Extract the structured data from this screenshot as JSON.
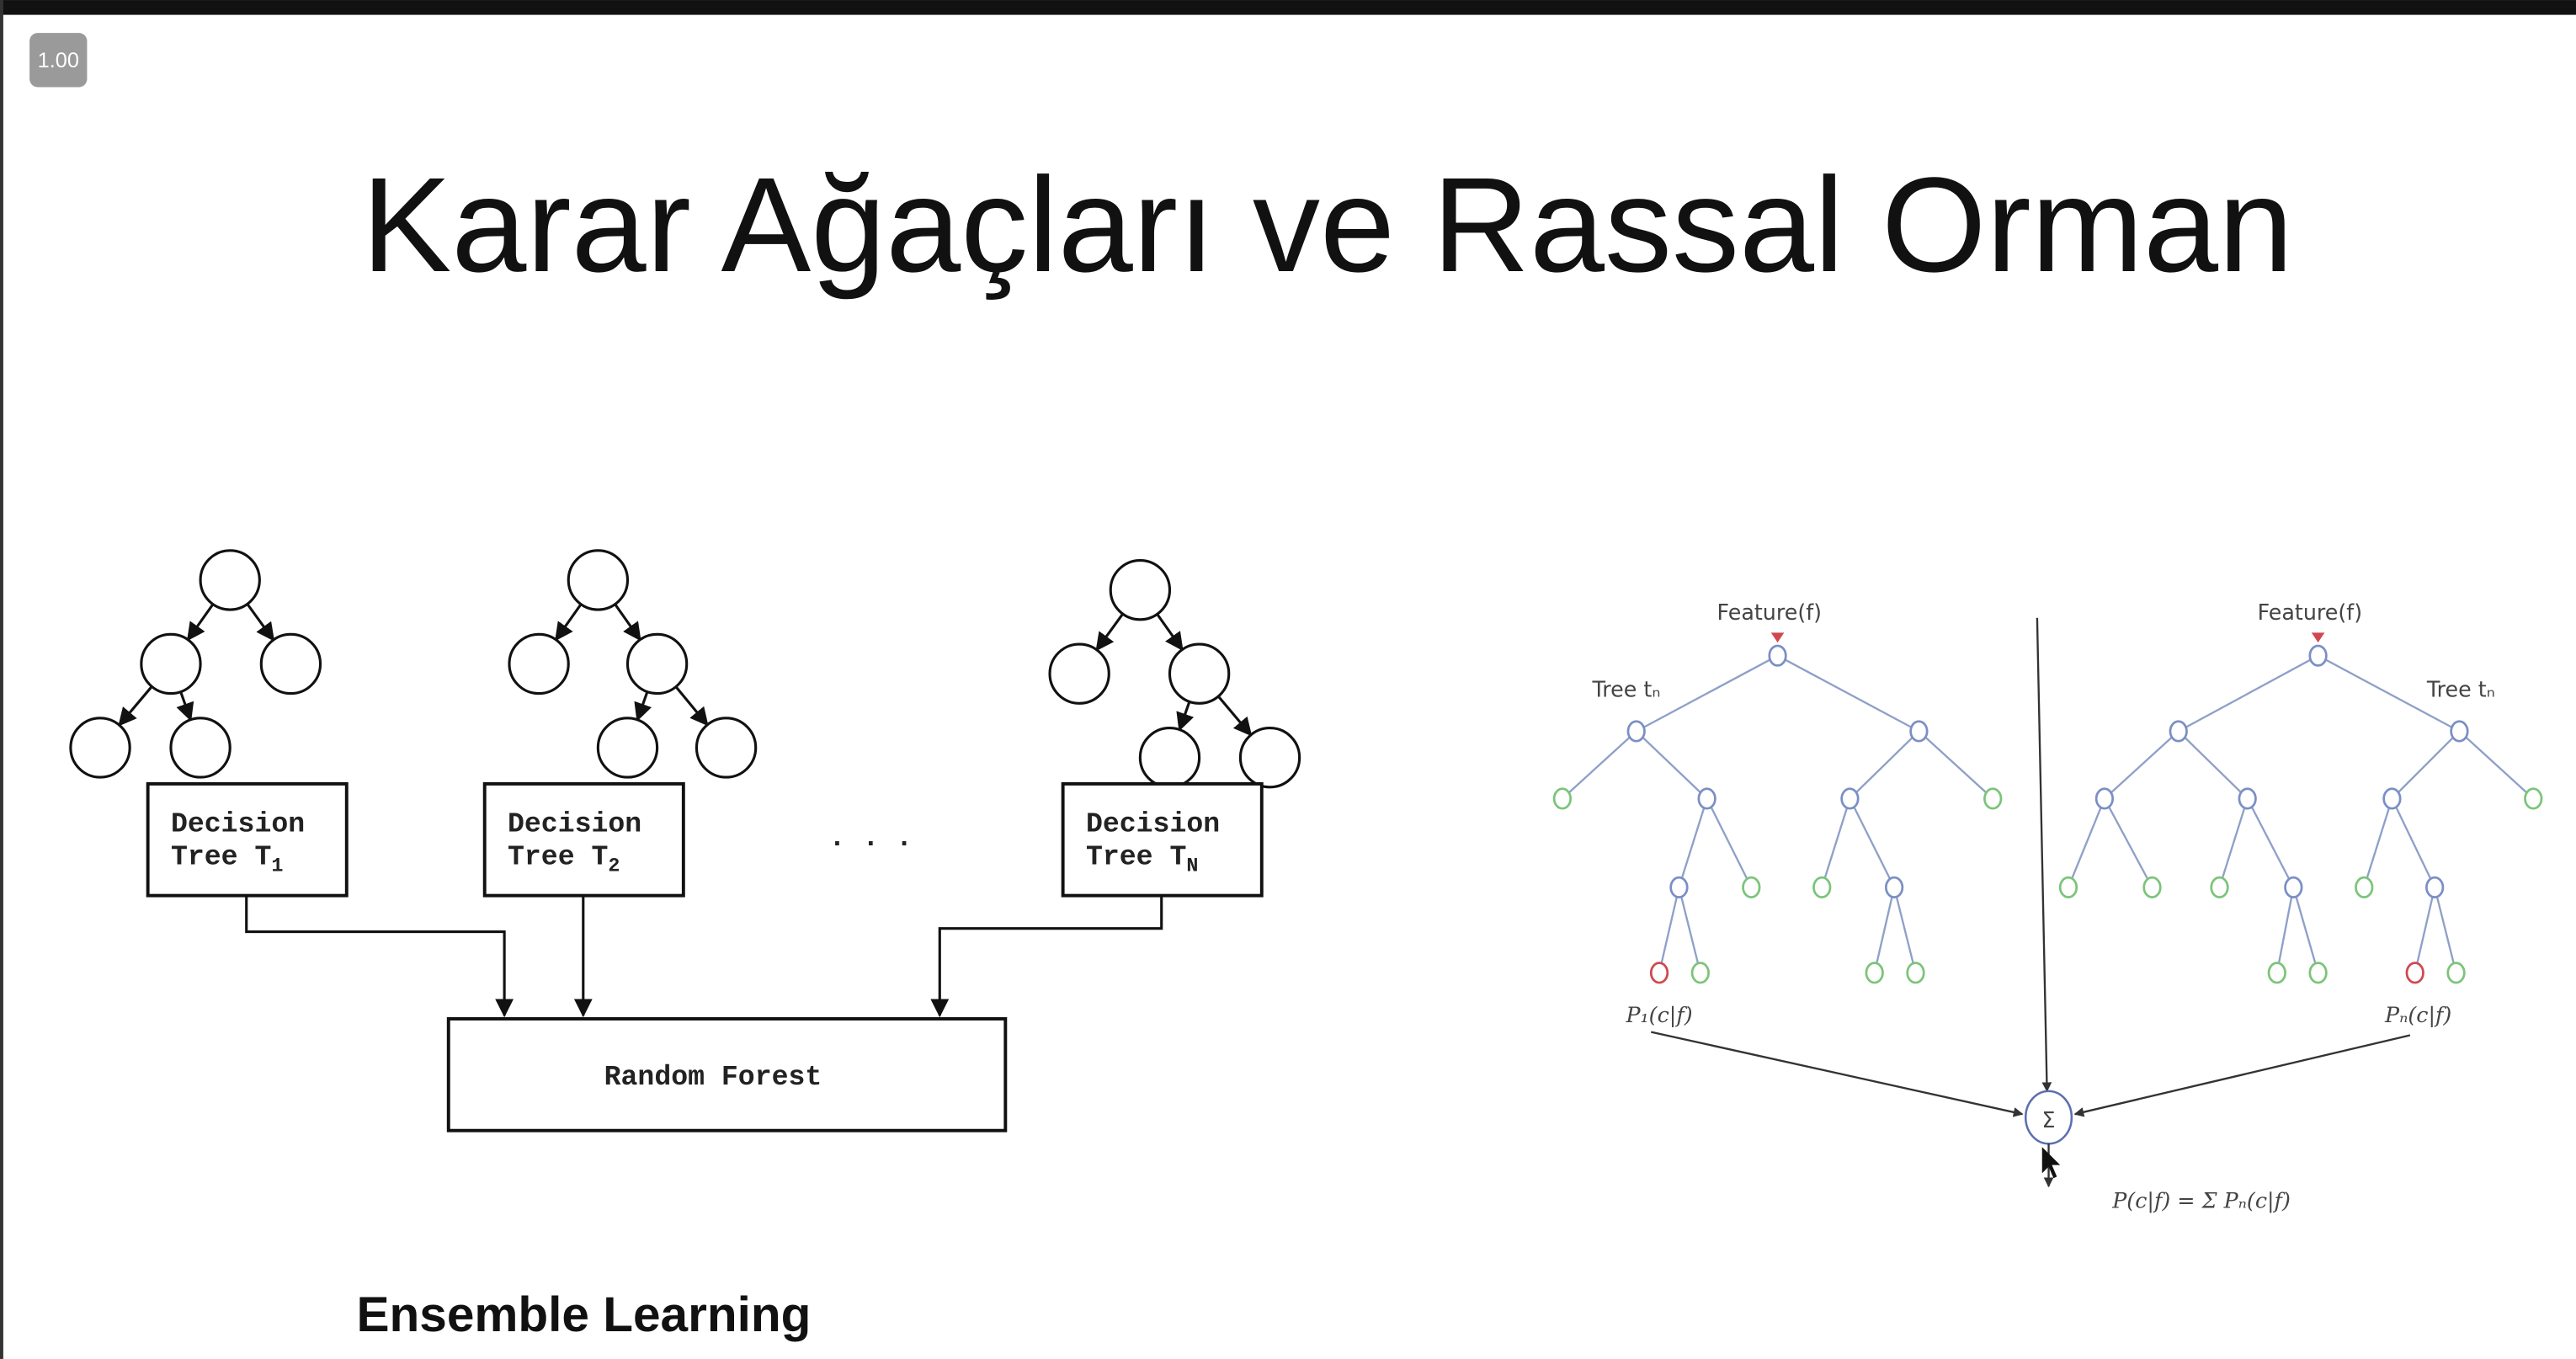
{
  "zoom_badge": "1.00",
  "slide": {
    "title": "Karar Ağaçları ve Rassal Orman",
    "subtitle": "Ensemble Learning"
  },
  "left_diagram": {
    "trees": [
      {
        "line1": "Decision",
        "line2": "Tree T",
        "sub": "1"
      },
      {
        "line1": "Decision",
        "line2": "Tree T",
        "sub": "2"
      },
      {
        "line1": "Decision",
        "line2": "Tree T",
        "sub": "N"
      }
    ],
    "ellipsis": "· · ·",
    "forest_label": "Random Forest"
  },
  "right_diagram": {
    "feature_label": "Feature(f)",
    "tree_label": "Tree tₙ",
    "p1_label": "P₁(c|f)",
    "pn_label": "Pₙ(c|f)",
    "sum_symbol": "Σ",
    "formula": "P(c|f) = Σ Pₙ(c|f)",
    "colors": {
      "inner": "#7b8fc4",
      "leaf": "#7cc47a",
      "class": "#d0484f",
      "edge": "#8fa0c8"
    }
  }
}
